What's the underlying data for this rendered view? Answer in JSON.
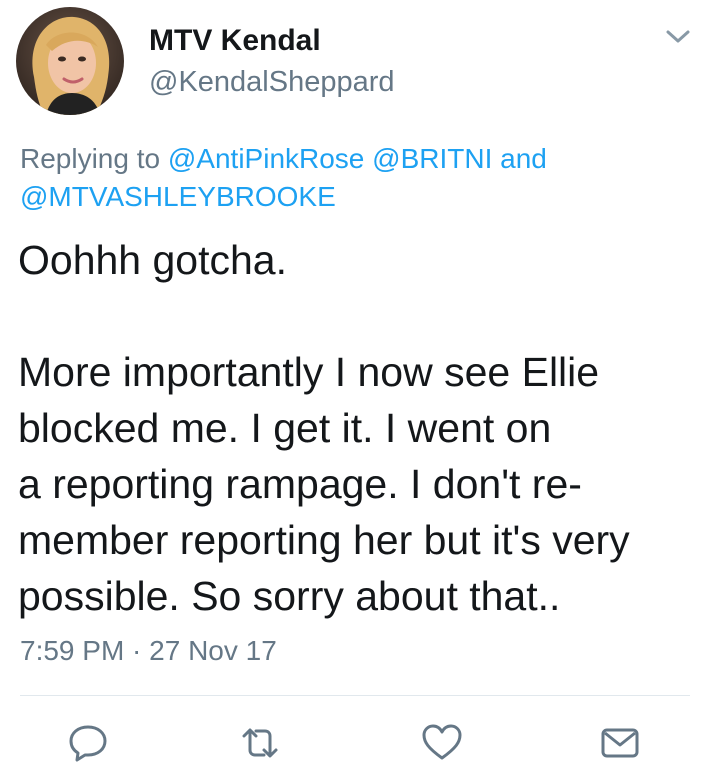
{
  "tweet": {
    "display_name": "MTV Kendal",
    "handle": "@KendalSheppard",
    "replying_prefix": "Replying to",
    "mentions": [
      "@AntiPinkRose",
      "@BRITNI",
      "@MTVASHLEYBROOKE"
    ],
    "replying_and": "and",
    "text_lines": [
      "Oohhh gotcha.",
      "",
      "More importantly I now see Ellie",
      "blocked me. I get it. I went on",
      "a reporting rampage. I don't re-",
      "member reporting her but it's very",
      "possible. So sorry about that.."
    ],
    "timestamp": "7:59 PM · 27 Nov 17"
  },
  "icons": {
    "caret": "chevron-down-icon",
    "reply": "reply-icon",
    "retweet": "retweet-icon",
    "like": "heart-icon",
    "message": "envelope-icon"
  },
  "colors": {
    "text": "#14171a",
    "secondary": "#657786",
    "link": "#1da1f2",
    "icon": "#657786",
    "divider": "#e1e8ed"
  }
}
